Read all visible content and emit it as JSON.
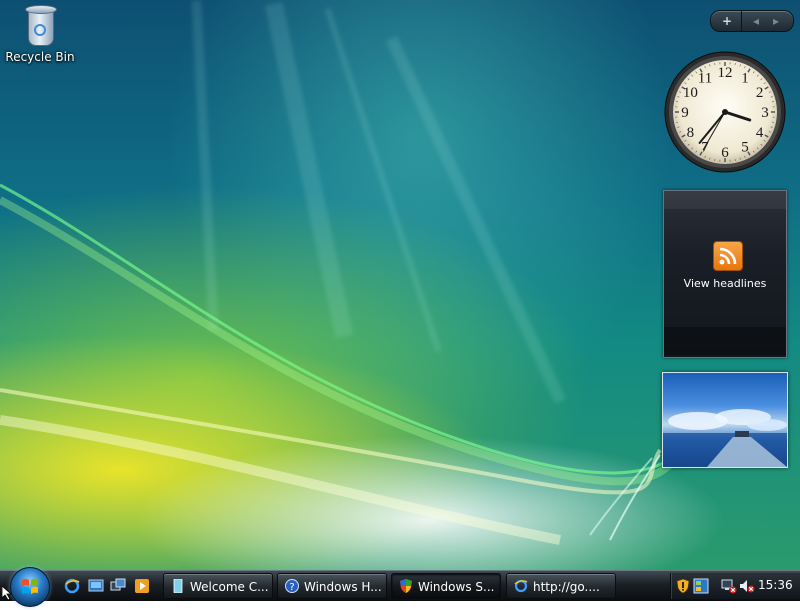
{
  "desktop": {
    "icons": [
      {
        "label": "Recycle Bin",
        "icon": "recycle-bin-icon"
      }
    ]
  },
  "sidebar": {
    "controls": {
      "add": "+",
      "prev": "◂",
      "next": "▸"
    },
    "clock": {
      "numerals": [
        "12",
        "1",
        "2",
        "3",
        "4",
        "5",
        "6",
        "7",
        "8",
        "9",
        "10",
        "11"
      ],
      "time": {
        "hours": 15,
        "minutes": 36,
        "seconds": 35
      }
    },
    "feed_headlines": {
      "label": "View headlines",
      "icon": "rss-icon"
    },
    "slideshow": {
      "icon": "landscape-photo"
    }
  },
  "taskbar": {
    "quick_launch": [
      "internet-explorer-icon",
      "show-desktop-icon",
      "switch-windows-icon",
      "media-player-icon"
    ],
    "tasks": [
      {
        "label": "Welcome C...",
        "icon": "welcome-center-icon",
        "active": false
      },
      {
        "label": "Windows H...",
        "icon": "help-icon",
        "active": false
      },
      {
        "label": "Windows S...",
        "icon": "security-shield-icon",
        "active": true
      },
      {
        "label": "http://go....",
        "icon": "internet-explorer-icon",
        "active": false
      }
    ],
    "tray": {
      "icons": [
        "security-warning-icon",
        "windows-sidebar-icon",
        "network-disconnected-icon",
        "volume-muted-icon"
      ],
      "time": "15:36"
    }
  },
  "colors": {
    "accent": "#2a7cc8",
    "taskbar": "#1a1f24",
    "rss": "#f08c22"
  }
}
